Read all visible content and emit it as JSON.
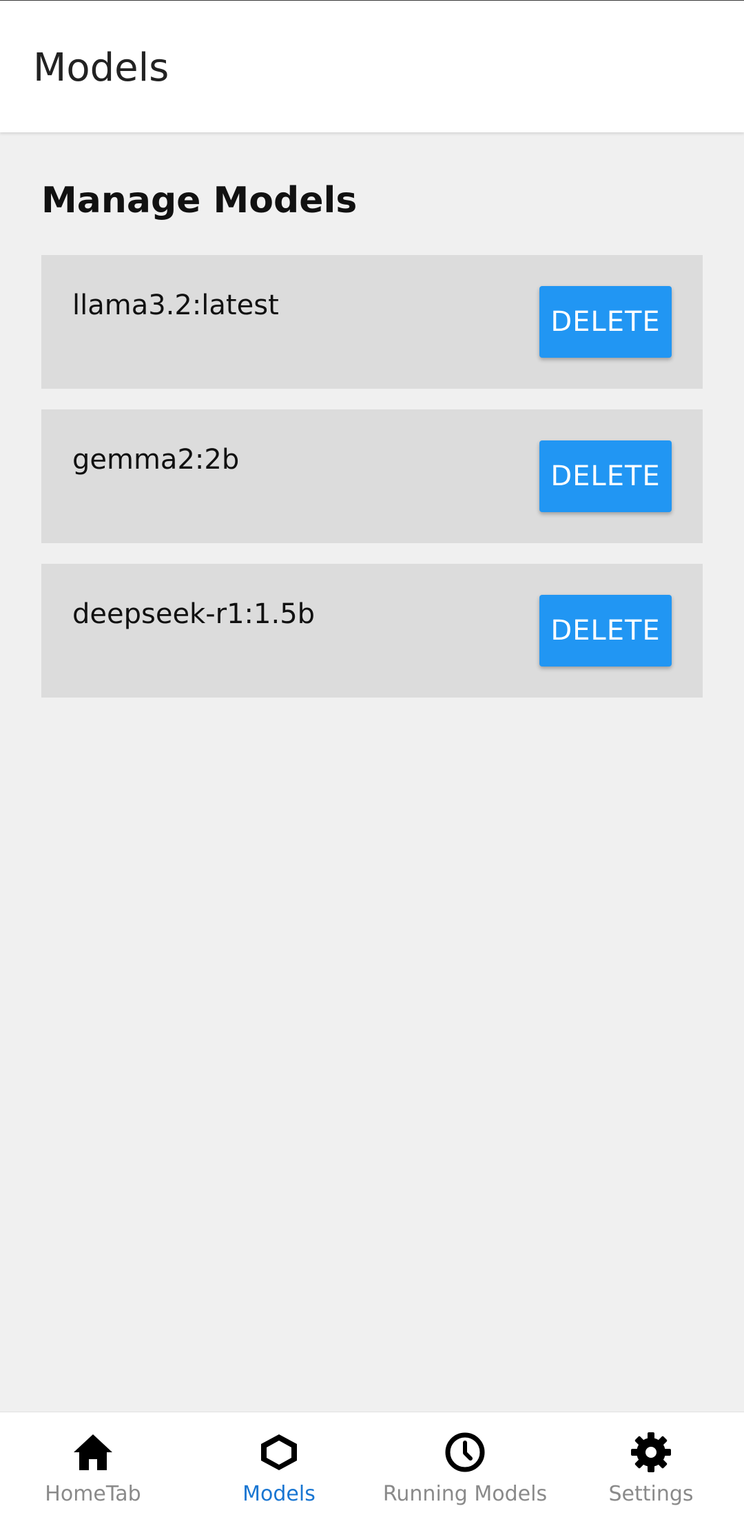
{
  "header": {
    "title": "Models"
  },
  "main": {
    "section_title": "Manage Models",
    "models": [
      {
        "name": "llama3.2:latest",
        "action_label": "DELETE"
      },
      {
        "name": "gemma2:2b",
        "action_label": "DELETE"
      },
      {
        "name": "deepseek-r1:1.5b",
        "action_label": "DELETE"
      }
    ]
  },
  "bottom_nav": {
    "active": "Models",
    "items": [
      {
        "label": "HomeTab",
        "icon": "home-icon"
      },
      {
        "label": "Models",
        "icon": "hexagon-icon"
      },
      {
        "label": "Running Models",
        "icon": "clock-icon"
      },
      {
        "label": "Settings",
        "icon": "gear-icon"
      }
    ]
  },
  "colors": {
    "accent": "#2196f3",
    "active_tab": "#1976d2",
    "card_background": "#dcdcdc",
    "page_background": "#f0f0f0"
  }
}
